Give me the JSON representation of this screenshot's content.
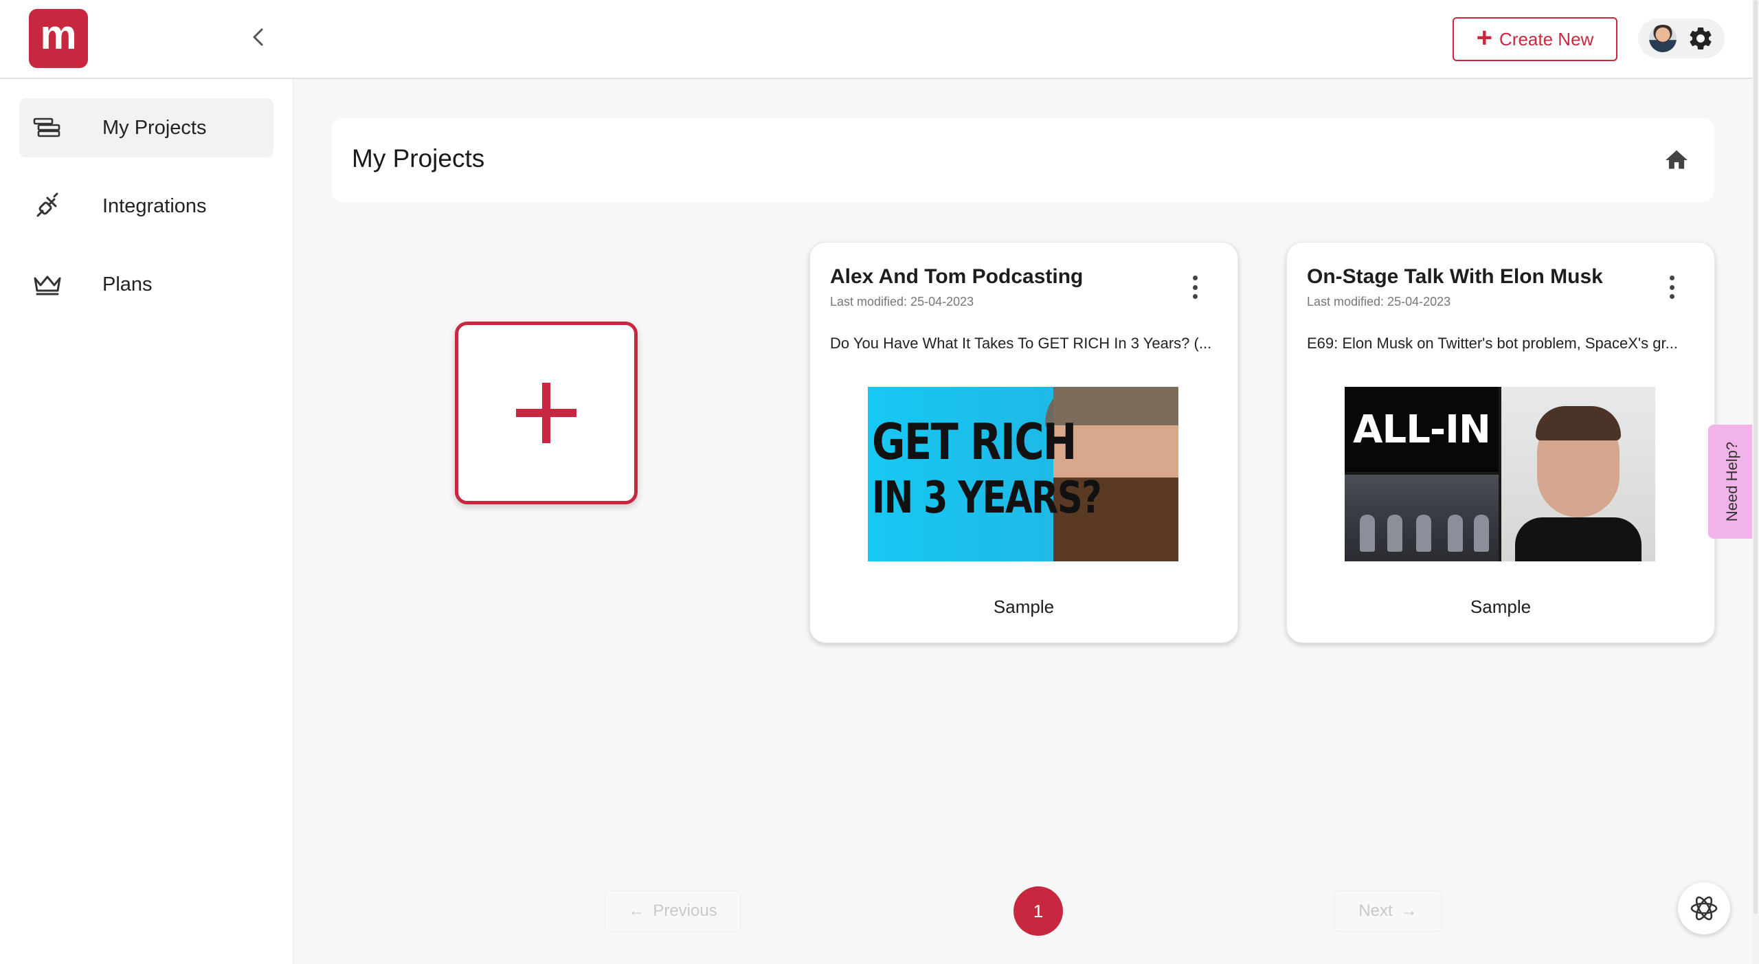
{
  "app": {
    "logo_letter": "m",
    "brand_color": "#c8283f"
  },
  "header": {
    "create_label": "Create New"
  },
  "sidebar": {
    "items": [
      {
        "label": "My Projects",
        "icon": "projects-icon",
        "active": true
      },
      {
        "label": "Integrations",
        "icon": "plug-icon",
        "active": false
      },
      {
        "label": "Plans",
        "icon": "crown-icon",
        "active": false
      }
    ]
  },
  "main": {
    "title": "My Projects",
    "projects": [
      {
        "title": "Alex And Tom Podcasting",
        "modified": "Last modified: 25-04-2023",
        "description": "Do You Have What It Takes To GET RICH In 3 Years? (...",
        "thumb_line1": "GET RICH",
        "thumb_line2": "IN 3 YEARS?",
        "tag": "Sample"
      },
      {
        "title": "On-Stage Talk With Elon Musk",
        "modified": "Last modified: 25-04-2023",
        "description": "E69: Elon Musk on Twitter's bot problem, SpaceX's gr...",
        "thumb_line1": "ALL-IN",
        "tag": "Sample"
      }
    ]
  },
  "pagination": {
    "previous": "Previous",
    "next": "Next",
    "current": "1"
  },
  "help": {
    "label": "Need Help?"
  }
}
